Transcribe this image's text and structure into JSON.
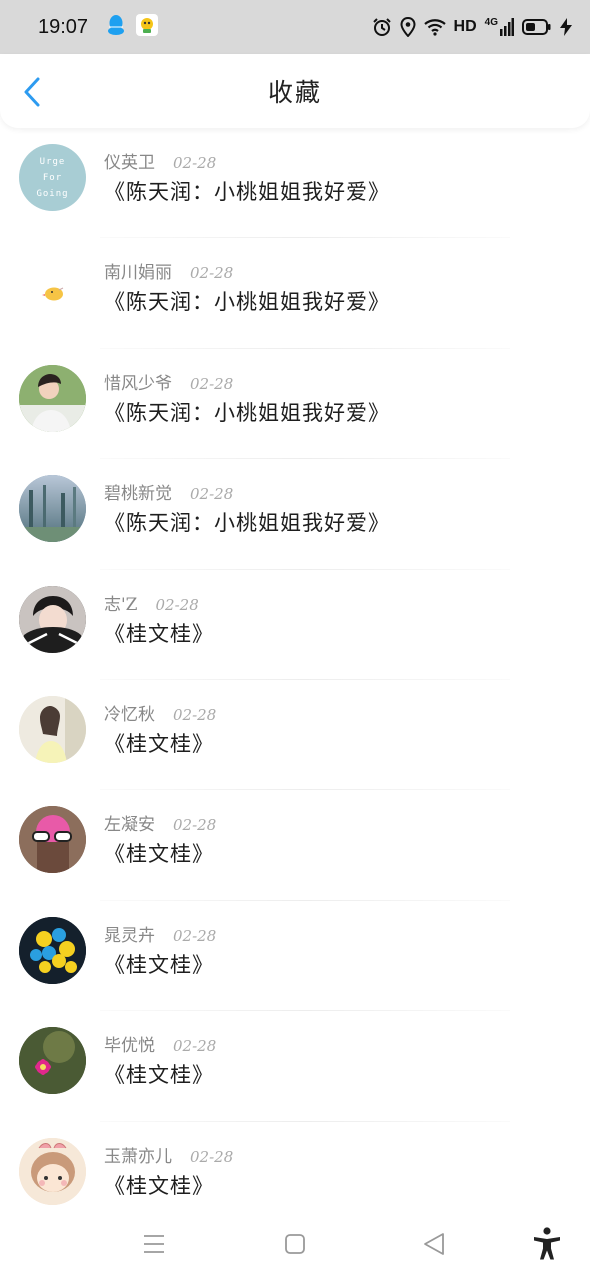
{
  "status_bar": {
    "time": "19:07",
    "app_icons": [
      "qq-penguin-icon",
      "qq-browser-icon"
    ],
    "indicators": [
      "alarm-icon",
      "location-icon",
      "wifi-icon",
      "hd-badge",
      "signal-4g-icon",
      "battery-icon",
      "charging-icon"
    ],
    "hd_label": "HD",
    "network_label": "4G"
  },
  "header": {
    "title": "收藏",
    "back_icon": "chevron-left-icon",
    "accent": "#2d9bf0"
  },
  "favorites": [
    {
      "user": "仪英卫",
      "date": "02-28",
      "title": "《陈天润：小桃姐姐我好爱》",
      "avatar_text": [
        "Urge",
        "For",
        "Going"
      ],
      "avatar_kind": "text-circle",
      "avatar_color": "#a8cdd4"
    },
    {
      "user": "南川娟丽",
      "date": "02-28",
      "title": "《陈天润：小桃姐姐我好爱》",
      "avatar_kind": "chick",
      "avatar_color": "#ffffff"
    },
    {
      "user": "惜风少爷",
      "date": "02-28",
      "title": "《陈天润：小桃姐姐我好爱》",
      "avatar_kind": "photo-man",
      "avatar_color": "#7fa36a"
    },
    {
      "user": "碧桃新觉",
      "date": "02-28",
      "title": "《陈天润：小桃姐姐我好爱》",
      "avatar_kind": "photo-forest",
      "avatar_color": "#6f8fa8"
    },
    {
      "user": "志'Z",
      "date": "02-28",
      "title": "《桂文桂》",
      "avatar_kind": "photo-boy",
      "avatar_color": "#3a3a3a"
    },
    {
      "user": "冷忆秋",
      "date": "02-28",
      "title": "《桂文桂》",
      "avatar_kind": "photo-girl",
      "avatar_color": "#e8e4d6"
    },
    {
      "user": "左凝安",
      "date": "02-28",
      "title": "《桂文桂》",
      "avatar_kind": "cartoon-pink",
      "avatar_color": "#7a5a4a"
    },
    {
      "user": "晁灵卉",
      "date": "02-28",
      "title": "《桂文桂》",
      "avatar_kind": "balloons",
      "avatar_color": "#14202c"
    },
    {
      "user": "毕优悦",
      "date": "02-28",
      "title": "《桂文桂》",
      "avatar_kind": "cactus-flower",
      "avatar_color": "#3b4a2a"
    },
    {
      "user": "玉萧亦儿",
      "date": "02-28",
      "title": "《桂文桂》",
      "avatar_kind": "cartoon-girl",
      "avatar_color": "#f4e3d0"
    }
  ],
  "nav_bar": {
    "buttons": [
      "menu-icon",
      "home-square-icon",
      "back-triangle-icon",
      "accessibility-icon"
    ]
  }
}
